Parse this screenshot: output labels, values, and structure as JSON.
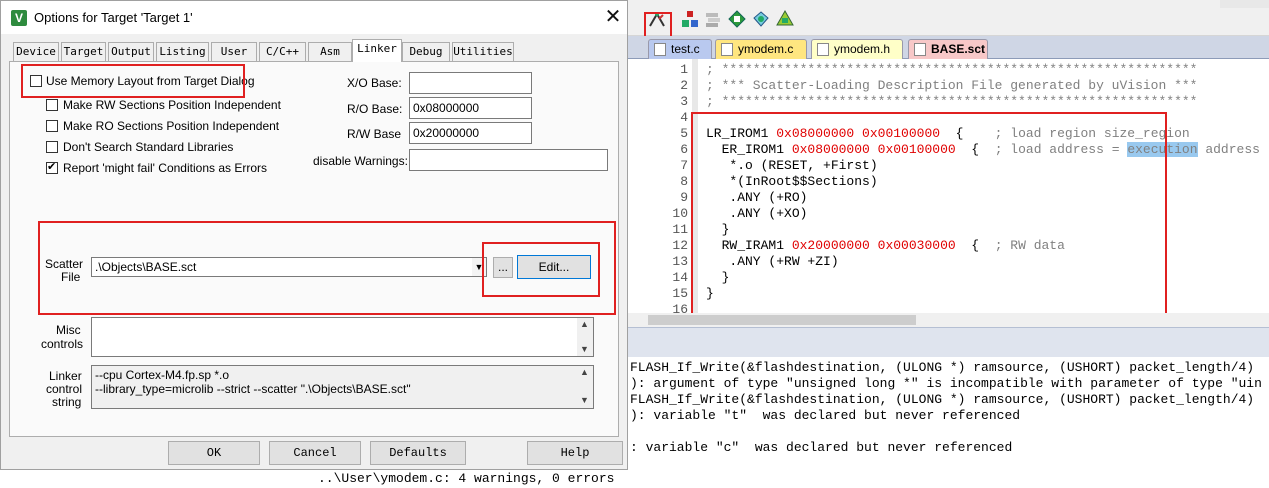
{
  "dialog": {
    "title": "Options for Target 'Target 1'",
    "close_glyph": "✕",
    "tabs": [
      "Device",
      "Target",
      "Output",
      "Listing",
      "User",
      "C/C++",
      "Asm",
      "Linker",
      "Debug",
      "Utilities"
    ],
    "active_tab": "Linker",
    "use_memory_layout": {
      "label": "Use Memory Layout from Target Dialog",
      "checked": false
    },
    "make_rw": {
      "label": "Make RW Sections Position Independent",
      "checked": false
    },
    "make_ro": {
      "label": "Make RO Sections Position Independent",
      "checked": false
    },
    "dont_search": {
      "label": "Don't Search Standard Libraries",
      "checked": false
    },
    "report_might_fail": {
      "label": "Report 'might fail' Conditions as Errors",
      "checked": true
    },
    "xo_base": {
      "label": "X/O Base:",
      "value": ""
    },
    "ro_base": {
      "label": "R/O Base:",
      "value": "0x08000000"
    },
    "rw_base": {
      "label": "R/W Base",
      "value": "0x20000000"
    },
    "disable_warnings": {
      "label": "disable Warnings:",
      "value": ""
    },
    "scatter_label_1": "Scatter",
    "scatter_label_2": "File",
    "scatter_file": ".\\Objects\\BASE.sct",
    "browse_label": "...",
    "edit_label": "Edit...",
    "misc_label_1": "Misc",
    "misc_label_2": "controls",
    "misc_value": "",
    "linker_label_1": "Linker",
    "linker_label_2": "control",
    "linker_label_3": "string",
    "linker_string_1": "--cpu Cortex-M4.fp.sp *.o",
    "linker_string_2": "--library_type=microlib --strict --scatter \".\\Objects\\BASE.sct\"",
    "buttons": {
      "ok": "OK",
      "cancel": "Cancel",
      "defaults": "Defaults",
      "help": "Help"
    }
  },
  "ide": {
    "toolbar_icons": [
      "options-for-target-icon",
      "manage-project-icon",
      "select-packs-icon",
      "manage-rte-icon",
      "pack-installer-icon",
      "component-icon"
    ],
    "file_tabs": [
      {
        "name": "test.c",
        "active": false,
        "color": "#b9c9ef"
      },
      {
        "name": "ymodem.c",
        "active": false,
        "color": "#ffe680"
      },
      {
        "name": "ymodem.h",
        "active": false,
        "color": "#ffffc8"
      },
      {
        "name": "BASE.sct",
        "active": true,
        "color": "#f7c8c8"
      }
    ],
    "line_numbers": [
      "1",
      "2",
      "3",
      "4",
      "5",
      "6",
      "7",
      "8",
      "9",
      "10",
      "11",
      "12",
      "13",
      "14",
      "15",
      "16"
    ],
    "code": {
      "l1": "; *************************************************************",
      "l2": "; *** Scatter-Loading Description File generated by uVision ***",
      "l3": "; *************************************************************",
      "l5_a": "LR_IROM1 ",
      "l5_b": "0x08000000",
      "l5_c": " ",
      "l5_d": "0x00100000",
      "l5_e": "  {    ",
      "l5_f": "; load region size_region",
      "l6_a": "  ER_IROM1 ",
      "l6_b": "0x08000000",
      "l6_c": " ",
      "l6_d": "0x00100000",
      "l6_e": "  {  ",
      "l6_f": "; load address = ",
      "l6_g": "execution",
      "l6_h": " address",
      "l7": "   *.o (RESET, +First)",
      "l8": "   *(InRoot$$Sections)",
      "l9": "   .ANY (+RO)",
      "l10": "   .ANY (+XO)",
      "l11": "  }",
      "l12_a": "  RW_IRAM1 ",
      "l12_b": "0x20000000",
      "l12_c": " ",
      "l12_d": "0x00030000",
      "l12_e": "  {  ",
      "l12_f": "; RW data",
      "l13": "   .ANY (+RW +ZI)",
      "l14": "  }",
      "l15": "}"
    },
    "output": {
      "line1": "FLASH_If_Write(&flashdestination, (ULONG *) ramsource, (USHORT) packet_length/4)",
      "line2": "): argument of type \"unsigned long *\" is incompatible with parameter of type \"uin",
      "line3": "FLASH_If_Write(&flashdestination, (ULONG *) ramsource, (USHORT) packet_length/4)",
      "line4": "): variable \"t\"  was declared but never referenced",
      "line5": ": variable \"c\"  was declared but never referenced",
      "summary": "..\\User\\ymodem.c: 4 warnings, 0 errors"
    }
  },
  "colors": {
    "annotation_red": "#e02020",
    "hex_red": "#e00000",
    "comment_gray": "#808080",
    "selection_blue": "#99c9ef"
  }
}
